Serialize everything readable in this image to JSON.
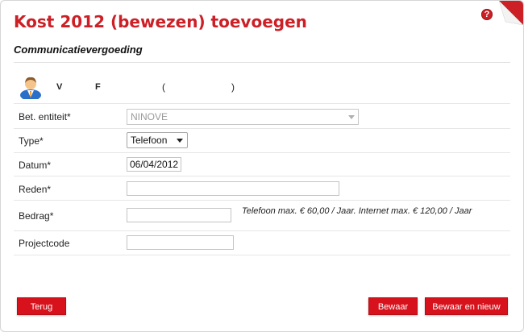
{
  "dialog": {
    "title": "Kost 2012 (bewezen) toevoegen",
    "help_icon": "?",
    "subtitle": "Communicatievergoeding"
  },
  "person": {
    "icon": "user-icon",
    "v": "V",
    "f": "F",
    "open_paren": "(",
    "close_paren": ")"
  },
  "form": {
    "entity_label": "Bet. entiteit*",
    "entity_value": "NINOVE",
    "type_label": "Type*",
    "type_value": "Telefoon",
    "date_label": "Datum*",
    "date_value": "06/04/2012",
    "reason_label": "Reden*",
    "reason_value": "",
    "amount_label": "Bedrag*",
    "amount_value": "",
    "amount_hint": "Telefoon max. € 60,00 / Jaar. Internet max. € 120,00 / Jaar",
    "project_label": "Projectcode",
    "project_value": ""
  },
  "buttons": {
    "back": "Terug",
    "save": "Bewaar",
    "save_new": "Bewaar en nieuw"
  },
  "colors": {
    "accent": "#cc1f26",
    "button": "#d7121c"
  }
}
